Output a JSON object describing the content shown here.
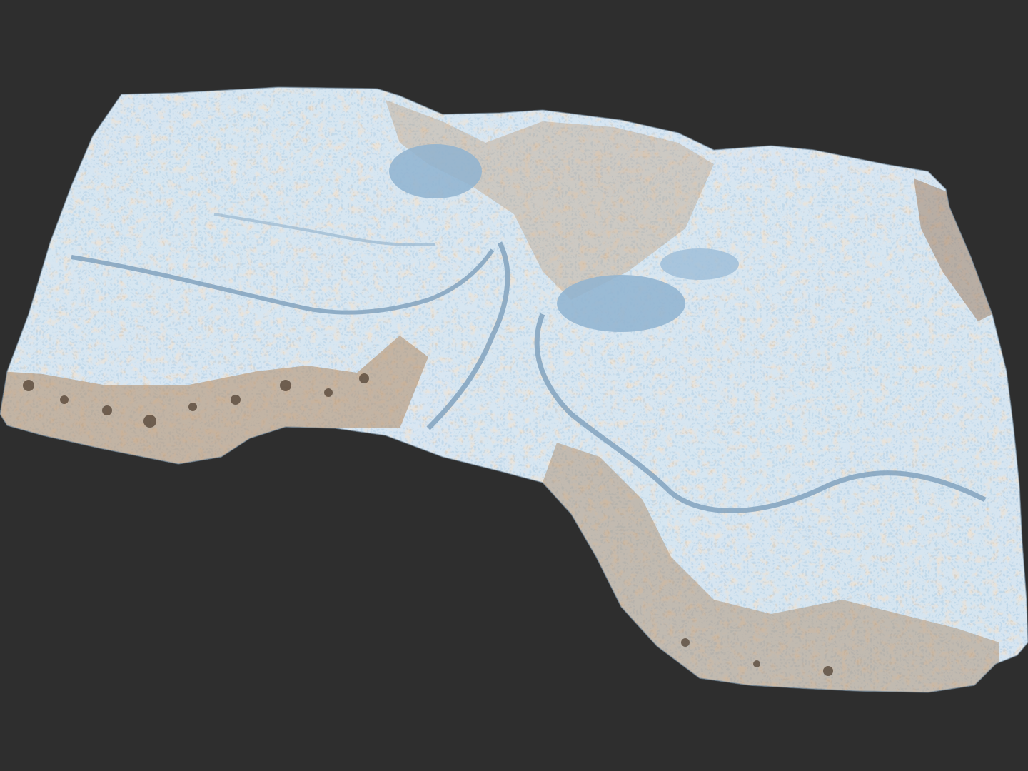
{
  "scene": {
    "subject": "terrain-model",
    "colors": {
      "background": "#2e2e2e",
      "terrain_light": "#cfe3f0",
      "terrain_mid": "#a9c9e0",
      "terrain_shadow": "#7ea5c4",
      "ridge_tan": "#c9a47e",
      "ridge_dark": "#6e5640",
      "river": "#9fc2dc"
    }
  }
}
